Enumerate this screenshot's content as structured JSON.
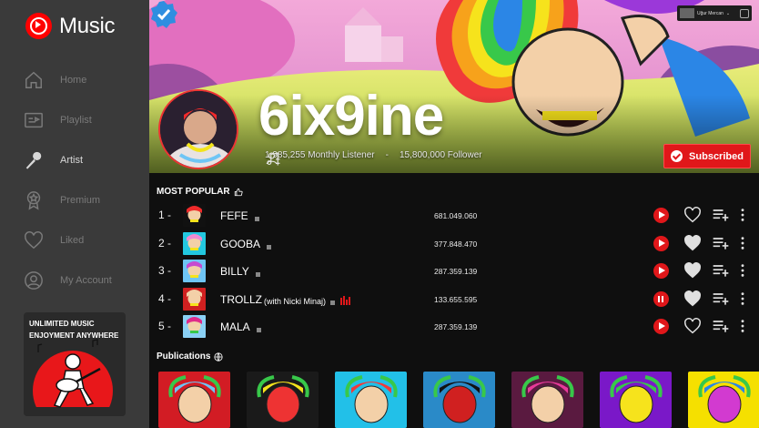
{
  "app": {
    "name": "Music"
  },
  "sidebar": {
    "items": [
      {
        "label": "Home",
        "icon": "home-icon",
        "active": false
      },
      {
        "label": "Playlist",
        "icon": "playlist-icon",
        "active": false
      },
      {
        "label": "Artist",
        "icon": "microphone-icon",
        "active": true
      },
      {
        "label": "Premium",
        "icon": "premium-badge-icon",
        "active": false
      },
      {
        "label": "Liked",
        "icon": "heart-icon",
        "active": false
      },
      {
        "label": "My Account",
        "icon": "user-circle-icon",
        "active": false
      }
    ],
    "promo": {
      "line1": "UNLIMITED MUSIC",
      "line2": "ENJOYMENT ANYWHERE"
    }
  },
  "header": {
    "user_name": "Uğur Mercan",
    "chevron": "⌄"
  },
  "artist": {
    "name": "6ix9ine",
    "verified": true,
    "monthly_listener": "1,985,255 Monthly Listener",
    "separator": "-",
    "followers": "15,800,000 Follower",
    "subscribe_label": "Subscribed"
  },
  "popular": {
    "title": "MOST POPULAR",
    "tracks": [
      {
        "rank": "1 -",
        "title": "FEFE",
        "feat": "",
        "plays": "681.049.060",
        "liked": false,
        "playing": false
      },
      {
        "rank": "2 -",
        "title": "GOOBA",
        "feat": "",
        "plays": "377.848.470",
        "liked": true,
        "playing": false
      },
      {
        "rank": "3 -",
        "title": "BILLY",
        "feat": "",
        "plays": "287.359.139",
        "liked": true,
        "playing": false
      },
      {
        "rank": "4 -",
        "title": "TROLLZ",
        "feat": "(with Nicki Minaj)",
        "plays": "133.655.595",
        "liked": true,
        "playing": true
      },
      {
        "rank": "5 -",
        "title": "MALA",
        "feat": "",
        "plays": "287.359.139",
        "liked": false,
        "playing": false
      }
    ]
  },
  "publications": {
    "title": "Publications",
    "count": 7
  },
  "colors": {
    "accent": "#e0171a",
    "sidebar": "#3a3a3a",
    "background": "#0f0f0f",
    "verified": "#2f8ee0"
  }
}
